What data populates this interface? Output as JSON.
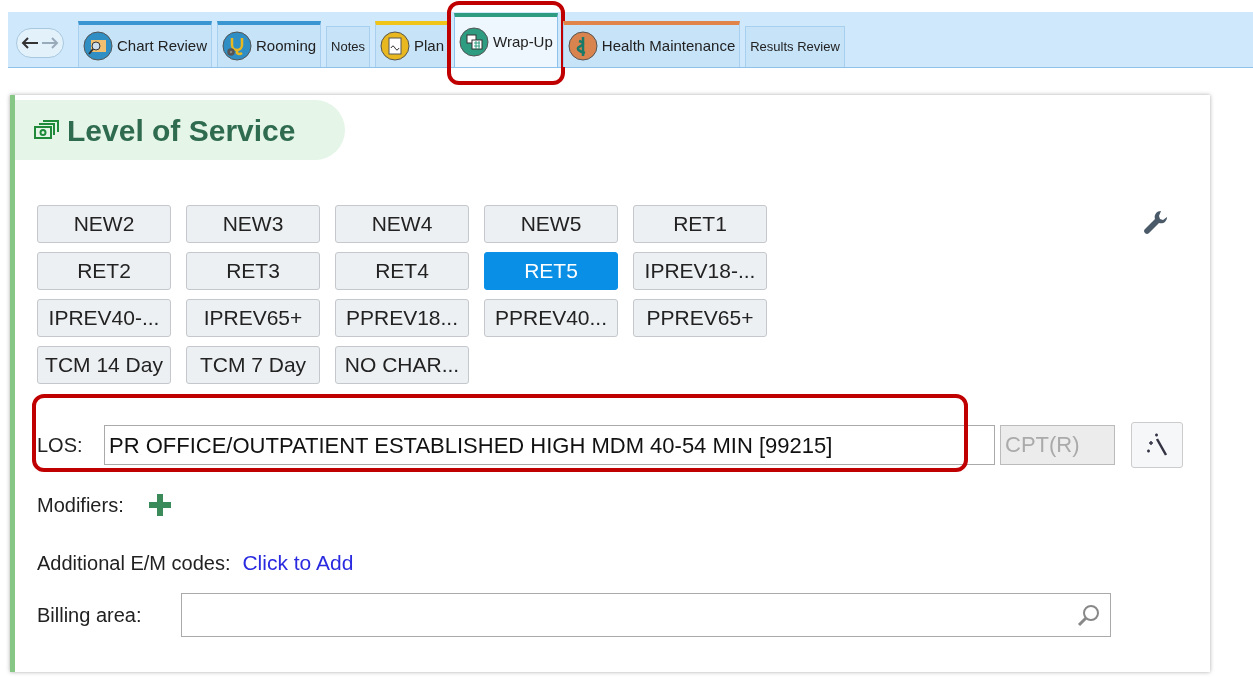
{
  "tabs": [
    {
      "label": "Chart Review",
      "kind": "chart",
      "color": "#3a96d0",
      "small": false,
      "selected": false
    },
    {
      "label": "Rooming",
      "kind": "stethoscope",
      "color": "#3a96d0",
      "small": false,
      "selected": false
    },
    {
      "label": "Notes",
      "small": true,
      "selected": false
    },
    {
      "label": "Plan",
      "kind": "clipboard",
      "color": "#f0c419",
      "small": false,
      "selected": false
    },
    {
      "label": "Wrap-Up",
      "kind": "calendar",
      "color": "#2e9c80",
      "small": false,
      "selected": true
    },
    {
      "label": "Health Maintenance",
      "kind": "caduceus",
      "color": "#e0844a",
      "small": false,
      "selected": false
    },
    {
      "label": "Results Review",
      "small": true,
      "selected": false
    }
  ],
  "section": {
    "title": "Level of Service"
  },
  "level_buttons": [
    {
      "label": "NEW2",
      "selected": false
    },
    {
      "label": "NEW3",
      "selected": false
    },
    {
      "label": "NEW4",
      "selected": false
    },
    {
      "label": "NEW5",
      "selected": false
    },
    {
      "label": "RET1",
      "selected": false
    },
    {
      "label": "RET2",
      "selected": false
    },
    {
      "label": "RET3",
      "selected": false
    },
    {
      "label": "RET4",
      "selected": false
    },
    {
      "label": "RET5",
      "selected": true
    },
    {
      "label": "IPREV18-...",
      "selected": false
    },
    {
      "label": "IPREV40-...",
      "selected": false
    },
    {
      "label": "IPREV65+",
      "selected": false
    },
    {
      "label": "PPREV18...",
      "selected": false
    },
    {
      "label": "PPREV40...",
      "selected": false
    },
    {
      "label": "PPREV65+",
      "selected": false
    },
    {
      "label": "TCM 14 Day",
      "selected": false
    },
    {
      "label": "TCM 7 Day",
      "selected": false
    },
    {
      "label": "NO CHAR...",
      "selected": false
    }
  ],
  "los": {
    "label": "LOS:",
    "value": "PR OFFICE/OUTPATIENT ESTABLISHED HIGH MDM 40-54 MIN [99215]",
    "code_placeholder": "CPT(R)",
    "code_disabled": true
  },
  "modifiers": {
    "label": "Modifiers:"
  },
  "additional_codes": {
    "label": "Additional E/M codes:",
    "link": "Click to Add"
  },
  "billing_area": {
    "label": "Billing area:"
  }
}
